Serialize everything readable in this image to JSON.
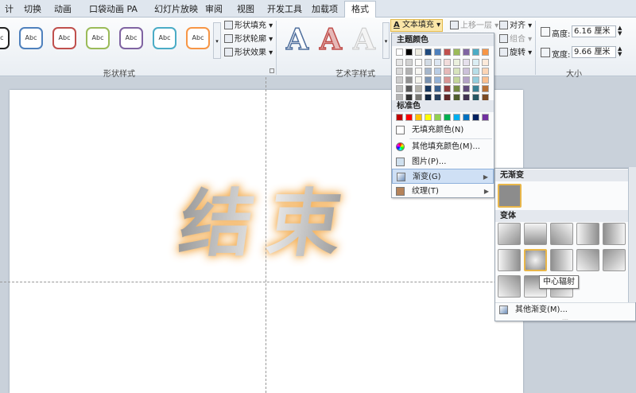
{
  "tabs": [
    "计",
    "切换",
    "动画",
    "口袋动画 PA",
    "幻灯片放映",
    "审阅",
    "视图",
    "开发工具",
    "加载项",
    "格式"
  ],
  "shape_styles": {
    "label": "形状样式",
    "swatch_text": "Abc",
    "swatch_colors": [
      "#222222",
      "#4f81bd",
      "#c0504d",
      "#9bbb59",
      "#8064a2",
      "#4bacc6",
      "#f79646"
    ],
    "fill": "形状填充",
    "outline": "形状轮廓",
    "effects": "形状效果"
  },
  "wordart": {
    "label": "艺术字样式",
    "letter": "A"
  },
  "text_fill_button": "文本填充",
  "arrange": {
    "bring_forward": "上移一层",
    "align": "对齐",
    "group": "组合",
    "rotate": "旋转"
  },
  "size": {
    "label": "大小",
    "height_label": "高度:",
    "height_value": "6.16 厘米",
    "width_label": "宽度:",
    "width_value": "9.66 厘米"
  },
  "slide_text": "结束",
  "menu": {
    "theme_colors_title": "主题颜色",
    "standard_colors_title": "标准色",
    "no_fill": "无填充颜色(N)",
    "more_colors": "其他填充颜色(M)...",
    "picture": "图片(P)...",
    "gradient": "渐变(G)",
    "texture": "纹理(T)"
  },
  "theme_colors": [
    "#ffffff",
    "#000000",
    "#eeece1",
    "#1f497d",
    "#4f81bd",
    "#c0504d",
    "#9bbb59",
    "#8064a2",
    "#4bacc6",
    "#f79646"
  ],
  "standard_colors": [
    "#c00000",
    "#ff0000",
    "#ffc000",
    "#ffff00",
    "#92d050",
    "#00b050",
    "#00b0f0",
    "#0070c0",
    "#002060",
    "#7030a0"
  ],
  "gradient_menu": {
    "no_gradient": "无渐变",
    "variants": "变体",
    "more": "其他渐变(M)...",
    "tooltip": "中心辐射"
  }
}
